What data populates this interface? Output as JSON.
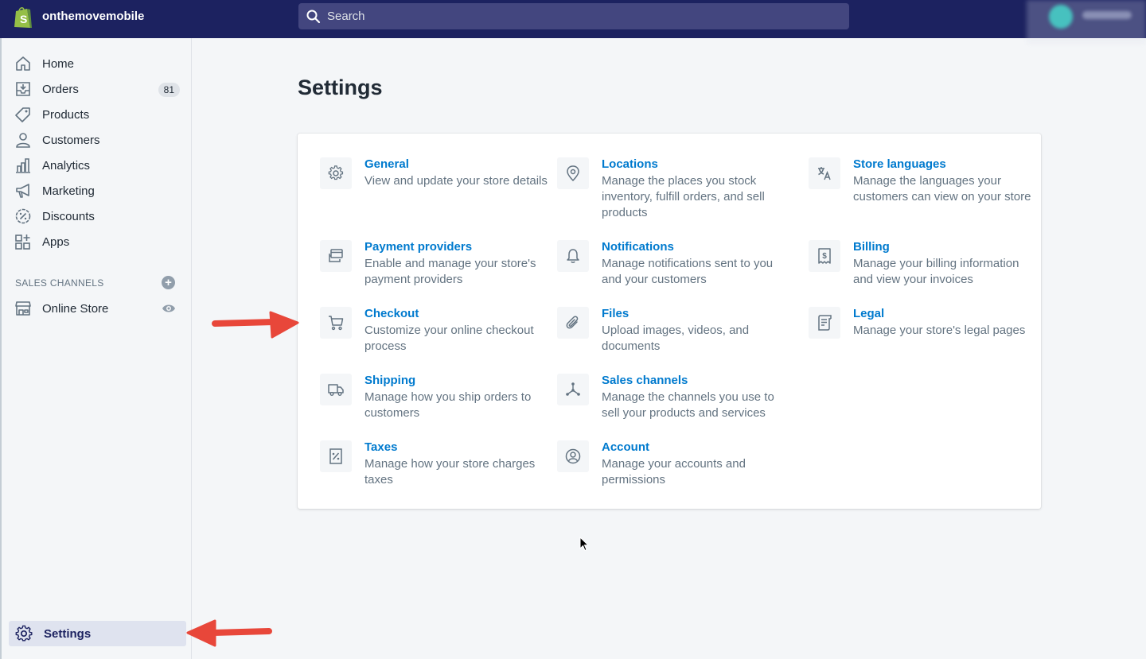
{
  "topbar": {
    "store_name": "onthemovemobile",
    "search_placeholder": "Search"
  },
  "sidebar": {
    "items": [
      {
        "label": "Home"
      },
      {
        "label": "Orders",
        "badge": "81"
      },
      {
        "label": "Products"
      },
      {
        "label": "Customers"
      },
      {
        "label": "Analytics"
      },
      {
        "label": "Marketing"
      },
      {
        "label": "Discounts"
      },
      {
        "label": "Apps"
      }
    ],
    "sales_channels_title": "SALES CHANNELS",
    "online_store_label": "Online Store",
    "settings_label": "Settings"
  },
  "main": {
    "title": "Settings",
    "settings": [
      {
        "name": "General",
        "desc": "View and update your store details",
        "icon": "gear-icon"
      },
      {
        "name": "Locations",
        "desc": "Manage the places you stock inventory, fulfill orders, and sell products",
        "icon": "location-pin-icon"
      },
      {
        "name": "Store languages",
        "desc": "Manage the languages your customers can view on your store",
        "icon": "translate-icon"
      },
      {
        "name": "Payment providers",
        "desc": "Enable and manage your store's payment providers",
        "icon": "payment-cards-icon"
      },
      {
        "name": "Notifications",
        "desc": "Manage notifications sent to you and your customers",
        "icon": "bell-icon"
      },
      {
        "name": "Billing",
        "desc": "Manage your billing information and view your invoices",
        "icon": "invoice-dollar-icon"
      },
      {
        "name": "Checkout",
        "desc": "Customize your online checkout process",
        "icon": "cart-icon"
      },
      {
        "name": "Files",
        "desc": "Upload images, videos, and documents",
        "icon": "paperclip-icon"
      },
      {
        "name": "Legal",
        "desc": "Manage your store's legal pages",
        "icon": "legal-document-icon"
      },
      {
        "name": "Shipping",
        "desc": "Manage how you ship orders to customers",
        "icon": "truck-icon"
      },
      {
        "name": "Sales channels",
        "desc": "Manage the channels you use to sell your products and services",
        "icon": "channels-icon"
      },
      {
        "name": "Taxes",
        "desc": "Manage how your store charges taxes",
        "icon": "tax-receipt-icon"
      },
      {
        "name": "Account",
        "desc": "Manage your accounts and permissions",
        "icon": "account-circle-icon"
      }
    ]
  },
  "colors": {
    "topbar": "#1c2260",
    "link": "#007ace",
    "annotation_arrow": "#e8473a"
  }
}
